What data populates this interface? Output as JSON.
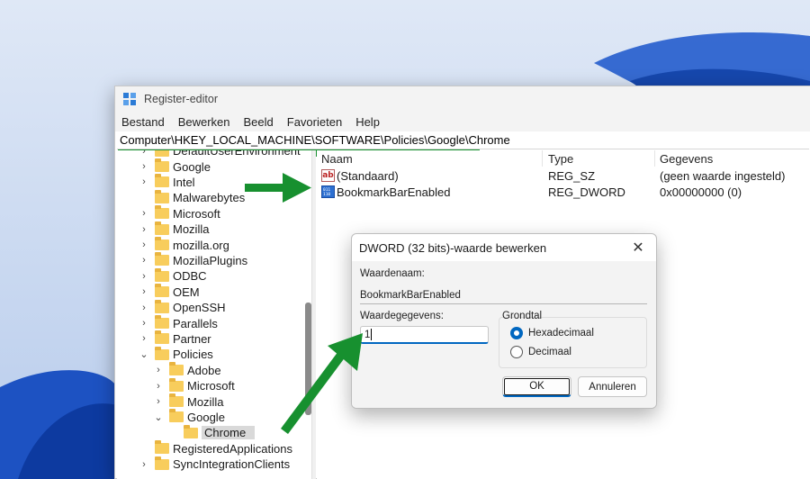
{
  "window": {
    "title": "Register-editor",
    "menu": [
      "Bestand",
      "Bewerken",
      "Beeld",
      "Favorieten",
      "Help"
    ],
    "address": "Computer\\HKEY_LOCAL_MACHINE\\SOFTWARE\\Policies\\Google\\Chrome"
  },
  "tree": {
    "items": [
      {
        "label": "DefaultUserEnvironment",
        "chevron": ">",
        "depth": 0
      },
      {
        "label": "Google",
        "chevron": ">",
        "depth": 0
      },
      {
        "label": "Intel",
        "chevron": ">",
        "depth": 0
      },
      {
        "label": "Malwarebytes",
        "chevron": "",
        "depth": 0
      },
      {
        "label": "Microsoft",
        "chevron": ">",
        "depth": 0
      },
      {
        "label": "Mozilla",
        "chevron": ">",
        "depth": 0
      },
      {
        "label": "mozilla.org",
        "chevron": ">",
        "depth": 0
      },
      {
        "label": "MozillaPlugins",
        "chevron": ">",
        "depth": 0
      },
      {
        "label": "ODBC",
        "chevron": ">",
        "depth": 0
      },
      {
        "label": "OEM",
        "chevron": ">",
        "depth": 0
      },
      {
        "label": "OpenSSH",
        "chevron": ">",
        "depth": 0
      },
      {
        "label": "Parallels",
        "chevron": ">",
        "depth": 0
      },
      {
        "label": "Partner",
        "chevron": ">",
        "depth": 0
      },
      {
        "label": "Policies",
        "chevron": "v",
        "depth": 0
      },
      {
        "label": "Adobe",
        "chevron": ">",
        "depth": 1
      },
      {
        "label": "Microsoft",
        "chevron": ">",
        "depth": 1
      },
      {
        "label": "Mozilla",
        "chevron": ">",
        "depth": 1
      },
      {
        "label": "Google",
        "chevron": "v",
        "depth": 1
      },
      {
        "label": "Chrome",
        "chevron": "",
        "depth": 2,
        "selected": true
      },
      {
        "label": "RegisteredApplications",
        "chevron": "",
        "depth": 0
      },
      {
        "label": "SyncIntegrationClients",
        "chevron": ">",
        "depth": 0
      }
    ]
  },
  "list": {
    "headers": {
      "name": "Naam",
      "type": "Type",
      "data": "Gegevens"
    },
    "rows": [
      {
        "icon": "string-value-icon",
        "icon_text": "ab",
        "name": "(Standaard)",
        "type": "REG_SZ",
        "data": "(geen waarde ingesteld)"
      },
      {
        "icon": "binary-value-icon",
        "icon_text": "011\n110",
        "name": "BookmarkBarEnabled",
        "type": "REG_DWORD",
        "data": "0x00000000 (0)"
      }
    ]
  },
  "dialog": {
    "title": "DWORD (32 bits)-waarde bewerken",
    "close": "✕",
    "value_name_label": "Waardenaam:",
    "value_name": "BookmarkBarEnabled",
    "value_data_label": "Waardegegevens:",
    "value_data": "1",
    "base_label": "Grondtal",
    "radio_hex": "Hexadecimaal",
    "radio_dec": "Decimaal",
    "base_selected": "hex",
    "ok": "OK",
    "cancel": "Annuleren"
  },
  "colors": {
    "annotation_green": "#17902f",
    "accent": "#0067c0",
    "wallpaper": "#1f55c9"
  }
}
